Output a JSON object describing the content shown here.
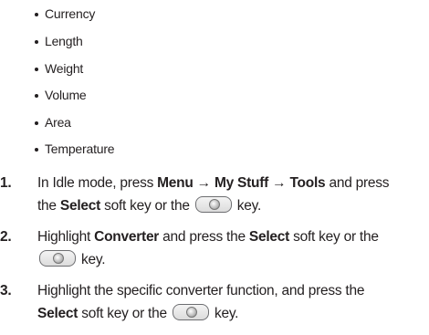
{
  "bullets": [
    "Currency",
    "Length",
    "Weight",
    "Volume",
    "Area",
    "Temperature"
  ],
  "steps": [
    {
      "number": "1.",
      "line1_a": "In Idle mode, press ",
      "menu": "Menu",
      "arrow1": " → ",
      "mystuff": "My Stuff",
      "arrow2": " → ",
      "tools": "Tools",
      "line1_b": " and press",
      "line2_a": "the ",
      "select": "Select",
      "line2_b": " soft key or the ",
      "line2_c": " key."
    },
    {
      "number": "2.",
      "line1_a": "Highlight ",
      "converter": "Converter",
      "line1_b": " and press the ",
      "select": "Select",
      "line1_c": " soft key or the",
      "line2_c": " key."
    },
    {
      "number": "3.",
      "line1": "Highlight the specific converter function, and press the",
      "select": "Select",
      "line2_b": " soft key or the ",
      "line2_c": " key."
    }
  ],
  "icons": {
    "select_key": "center-select-key-icon"
  }
}
